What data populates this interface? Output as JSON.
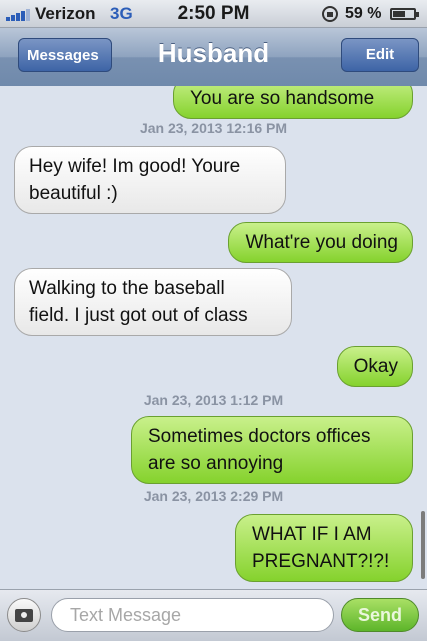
{
  "status_bar": {
    "carrier": "Verizon",
    "network": "3G",
    "time": "2:50 PM",
    "battery_percent": "59 %",
    "battery_level": 0.59
  },
  "nav": {
    "back_label": "Messages",
    "title": "Husband",
    "edit_label": "Edit"
  },
  "messages": [
    {
      "type": "sent",
      "text": "You are so handsome"
    },
    {
      "type": "timestamp",
      "text": "Jan 23, 2013 12:16 PM"
    },
    {
      "type": "received",
      "lines": [
        "Hey wife! Im good! Youre",
        "beautiful :)"
      ]
    },
    {
      "type": "sent",
      "text": "What're you doing"
    },
    {
      "type": "received",
      "lines": [
        "Walking to the baseball",
        "field. I just got out of class"
      ]
    },
    {
      "type": "sent",
      "text": "Okay"
    },
    {
      "type": "timestamp",
      "text": "Jan 23, 2013 1:12 PM"
    },
    {
      "type": "sent",
      "lines": [
        "Sometimes doctors offices",
        "are so annoying"
      ]
    },
    {
      "type": "timestamp",
      "text": "Jan 23, 2013 2:29 PM"
    },
    {
      "type": "sent",
      "lines": [
        "WHAT IF I AM",
        "PREGNANT?!?!"
      ]
    }
  ],
  "input_bar": {
    "camera_icon": "camera-icon",
    "placeholder": "Text Message",
    "send_label": "Send"
  }
}
